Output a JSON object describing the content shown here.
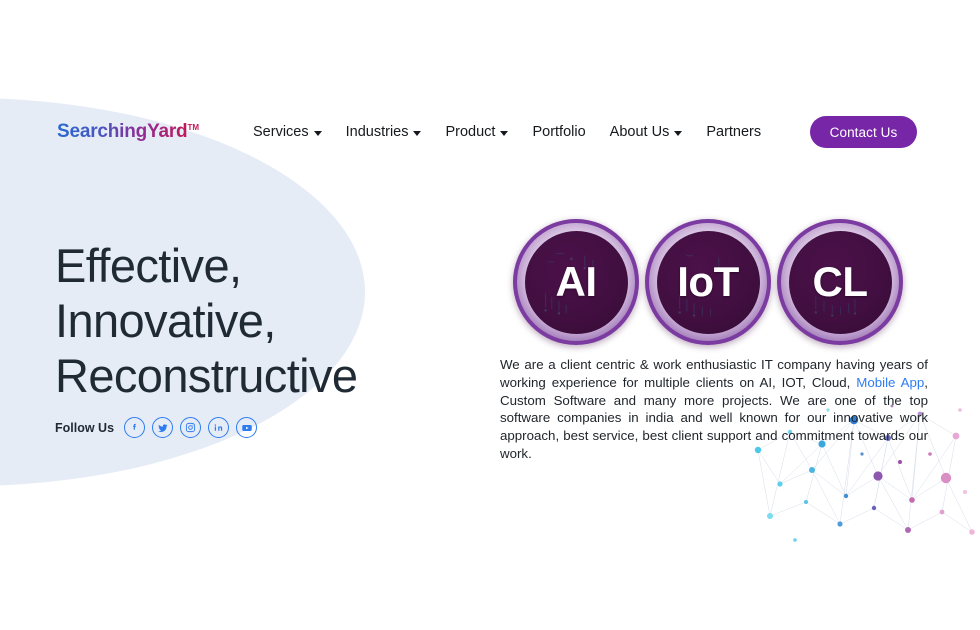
{
  "colors": {
    "blob": "#e6ecf6",
    "accent_purple": "#7826a8",
    "badge_dark": "#420f41",
    "link_blue": "#2f7cf0",
    "headline": "#1f2a35",
    "logo_gradient_start": "#2a68cf",
    "logo_gradient_end": "#c2185b"
  },
  "header": {
    "logo": {
      "text": "SearchingYard",
      "trademark": "TM"
    },
    "nav_items": [
      {
        "label": "Services",
        "has_dropdown": true
      },
      {
        "label": "Industries",
        "has_dropdown": true
      },
      {
        "label": "Product",
        "has_dropdown": true
      },
      {
        "label": "Portfolio",
        "has_dropdown": false
      },
      {
        "label": "About Us",
        "has_dropdown": true
      },
      {
        "label": "Partners",
        "has_dropdown": false
      }
    ],
    "cta_button": "Contact Us"
  },
  "hero": {
    "headline_line1": "Effective,",
    "headline_line2": "Innovative,",
    "headline_line3": "Reconstructive",
    "follow_us_label": "Follow Us",
    "social_links": [
      {
        "name": "facebook-icon",
        "title": "Facebook"
      },
      {
        "name": "twitter-icon",
        "title": "Twitter"
      },
      {
        "name": "instagram-icon",
        "title": "Instagram"
      },
      {
        "name": "linkedin-icon",
        "title": "LinkedIn"
      },
      {
        "name": "youtube-icon",
        "title": "YouTube"
      }
    ],
    "badges": [
      {
        "label": "AI"
      },
      {
        "label": "IoT"
      },
      {
        "label": "CL"
      }
    ],
    "paragraph": {
      "part1": "We are a client centric & work enthusiastic IT company having years of working experience for multiple clients on AI, IOT, Cloud, ",
      "link": "Mobile App",
      "part2": ", Custom Software and many more projects. We are one of the top software companies in india and well known for our innovative work approach, best service, best client support and commitment towards our work."
    }
  }
}
